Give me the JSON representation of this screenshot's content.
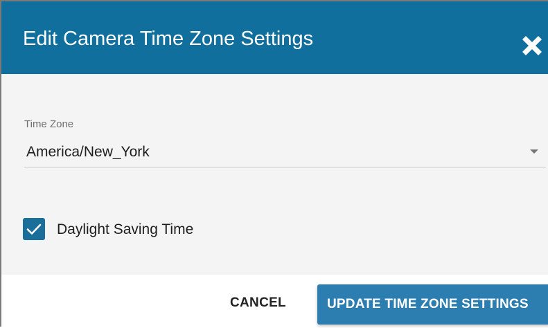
{
  "dialog": {
    "title": "Edit Camera Time Zone Settings",
    "close_icon": "close-icon"
  },
  "form": {
    "time_zone_label": "Time Zone",
    "time_zone_value": "America/New_York",
    "dropdown_icon": "caret-down-icon",
    "daylight_saving_label": "Daylight Saving Time",
    "daylight_saving_checked": true,
    "checkmark_icon": "checkmark-icon"
  },
  "actions": {
    "cancel_label": "CANCEL",
    "update_label": "UPDATE TIME ZONE SETTINGS"
  },
  "colors": {
    "header": "#116f9e",
    "primary_button": "#2c7db0",
    "checkbox": "#1a6e9a",
    "body_background": "#f4f4f4"
  }
}
